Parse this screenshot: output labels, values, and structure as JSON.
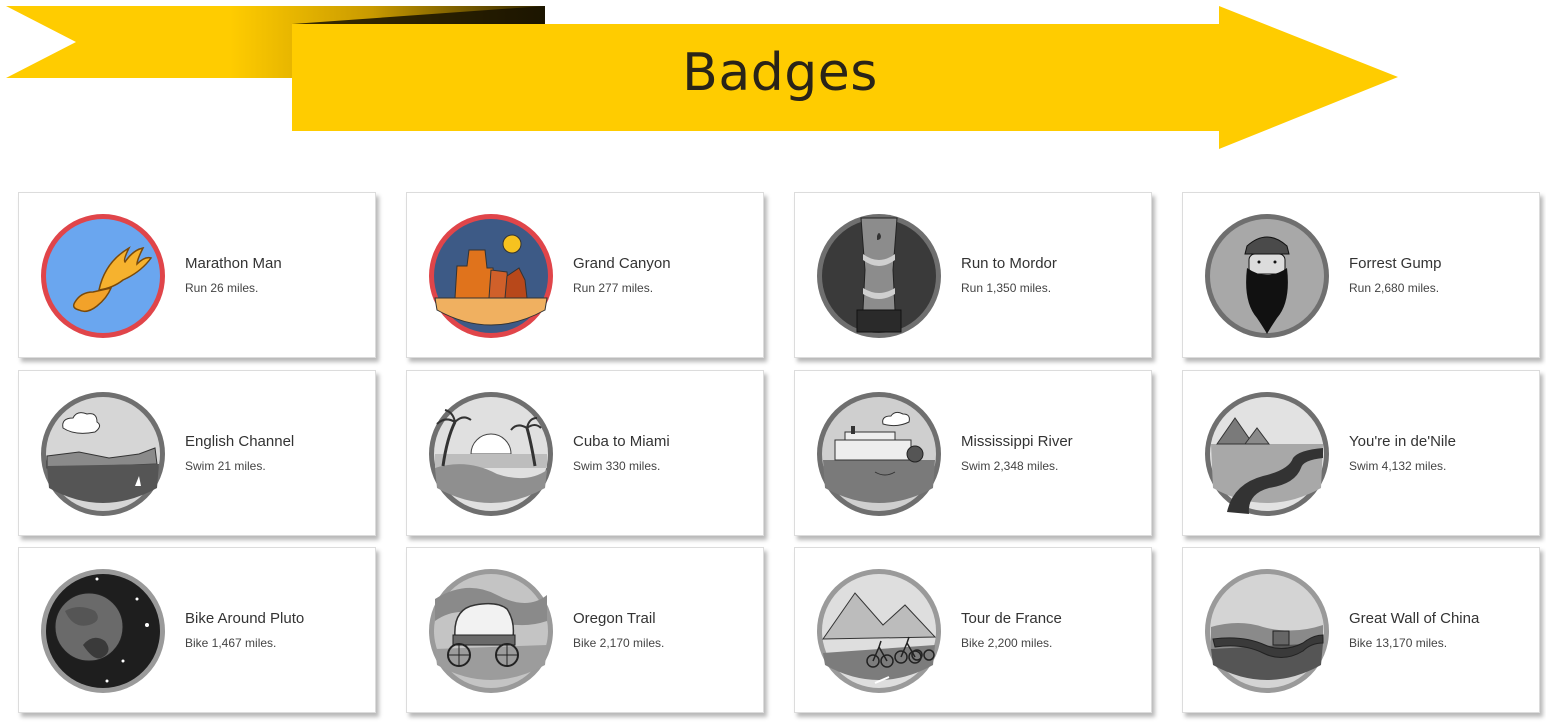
{
  "header": {
    "title": "Badges"
  },
  "colors": {
    "banner": "#FFCC00",
    "banner_fold_dark": "#3A2C00"
  },
  "badges": [
    {
      "title": "Marathon Man",
      "goal": "Run 26 miles.",
      "icon": "winged-shoe-icon",
      "earned": true
    },
    {
      "title": "Grand Canyon",
      "goal": "Run 277 miles.",
      "icon": "canyon-icon",
      "earned": true
    },
    {
      "title": "Run to Mordor",
      "goal": "Run 1,350 miles.",
      "icon": "tower-icon",
      "earned": false
    },
    {
      "title": "Forrest Gump",
      "goal": "Run 2,680 miles.",
      "icon": "bearded-man-icon",
      "earned": false
    },
    {
      "title": "English Channel",
      "goal": "Swim 21 miles.",
      "icon": "cliffs-icon",
      "earned": false
    },
    {
      "title": "Cuba to Miami",
      "goal": "Swim 330 miles.",
      "icon": "palm-sunset-icon",
      "earned": false
    },
    {
      "title": "Mississippi River",
      "goal": "Swim 2,348 miles.",
      "icon": "steamboat-icon",
      "earned": false
    },
    {
      "title": "You're in de'Nile",
      "goal": "Swim 4,132 miles.",
      "icon": "pyramids-icon",
      "earned": false
    },
    {
      "title": "Bike Around Pluto",
      "goal": "Bike 1,467 miles.",
      "icon": "planet-icon",
      "earned": false
    },
    {
      "title": "Oregon Trail",
      "goal": "Bike 2,170 miles.",
      "icon": "wagon-icon",
      "earned": false
    },
    {
      "title": "Tour de France",
      "goal": "Bike 2,200 miles.",
      "icon": "cyclists-icon",
      "earned": false
    },
    {
      "title": "Great Wall of China",
      "goal": "Bike 13,170 miles.",
      "icon": "great-wall-icon",
      "earned": false
    }
  ]
}
